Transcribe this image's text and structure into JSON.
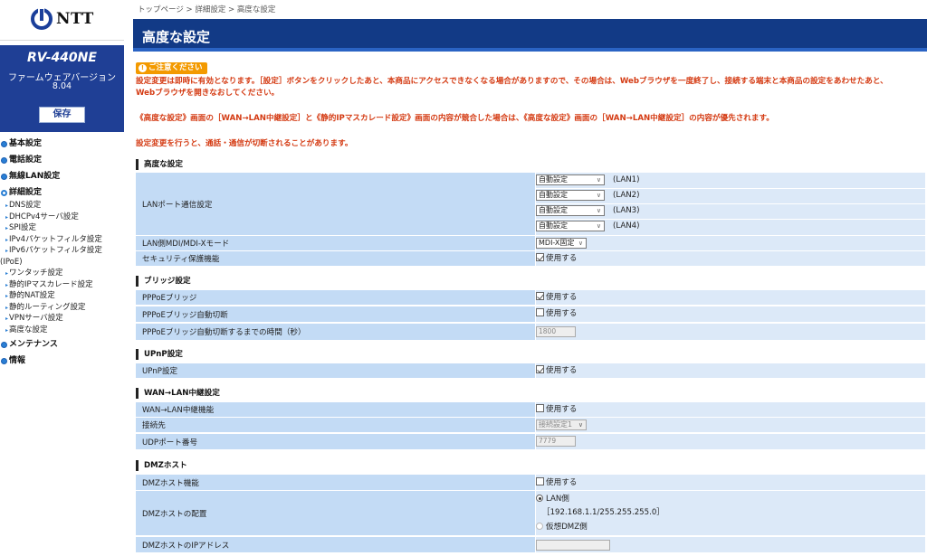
{
  "sidebar": {
    "logo_text": "NTT",
    "model": "RV-440NE",
    "firmware_label": "ファームウェアバージョン",
    "firmware_version": "8.04",
    "save_label": "保存",
    "nav": {
      "basic": "基本設定",
      "phone": "電話設定",
      "wlan": "無線LAN設定",
      "detail": "詳細設定",
      "detail_items": [
        "DNS設定",
        "DHCPv4サーバ設定",
        "SPI設定",
        "IPv4パケットフィルタ設定",
        "IPv6パケットフィルタ設定",
        "(IPoE)",
        "ワンタッチ設定",
        "静的IPマスカレード設定",
        "静的NAT設定",
        "静的ルーティング設定",
        "VPNサーバ設定",
        "高度な設定"
      ],
      "maintenance": "メンテナンス",
      "info": "情報"
    }
  },
  "breadcrumb": "トップページ > 詳細設定 > 高度な設定",
  "page_title": "高度な設定",
  "notice": {
    "badge": "ご注意ください",
    "line1": "設定変更は即時に有効となります。［設定］ボタンをクリックしたあと、本商品にアクセスできなくなる場合がありますので、その場合は、Webブラウザを一度終了し、接続する端末と本商品の設定をあわせたあと、",
    "line2": "Webブラウザを開きなおしてください。",
    "line3": "《高度な設定》画面の［WAN→LAN中継設定］と《静的IPマスカレード設定》画面の内容が競合した場合は、《高度な設定》画面の［WAN→LAN中継設定］の内容が優先されます。",
    "line4": "設定変更を行うと、通話・通信が切断されることがあります。"
  },
  "sections": {
    "advanced": {
      "heading": "高度な設定",
      "lan_port_label": "LANポート通信設定",
      "lan_ports": [
        {
          "value": "自動設定",
          "tag": "(LAN1)"
        },
        {
          "value": "自動設定",
          "tag": "(LAN2)"
        },
        {
          "value": "自動設定",
          "tag": "(LAN3)"
        },
        {
          "value": "自動設定",
          "tag": "(LAN4)"
        }
      ],
      "mdi_label": "LAN側MDI/MDI-Xモード",
      "mdi_value": "MDI-X固定",
      "security_label": "セキュリティ保護機能",
      "security_check": "使用する"
    },
    "bridge": {
      "heading": "ブリッジ設定",
      "pppoe_label": "PPPoEブリッジ",
      "pppoe_check": "使用する",
      "auto_cut_label": "PPPoEブリッジ自動切断",
      "auto_cut_check": "使用する",
      "time_label": "PPPoEブリッジ自動切断するまでの時間（秒）",
      "time_value": "1800"
    },
    "upnp": {
      "heading": "UPnP設定",
      "label": "UPnP設定",
      "check": "使用する"
    },
    "wan": {
      "heading": "WAN→LAN中継設定",
      "func_label": "WAN→LAN中継機能",
      "func_check": "使用する",
      "dest_label": "接続先",
      "dest_value": "接続設定1",
      "udp_label": "UDPポート番号",
      "udp_value": "7779"
    },
    "dmz": {
      "heading": "DMZホスト",
      "func_label": "DMZホスト機能",
      "func_check": "使用する",
      "place_label": "DMZホストの配置",
      "lan_option": "LAN側",
      "lan_detail": "［192.168.1.1/255.255.255.0］",
      "virtual_option": "仮想DMZ側",
      "ip_label": "DMZホストのIPアドレス",
      "ip_value": ""
    }
  },
  "colors": {
    "title_bar": "#123a86",
    "sidebar_model_bg": "#1f3f95",
    "notice_text": "#d43a12",
    "badge": "#f39a00",
    "label_cell": "#c3dbf5",
    "value_cell": "#dce9f8"
  }
}
